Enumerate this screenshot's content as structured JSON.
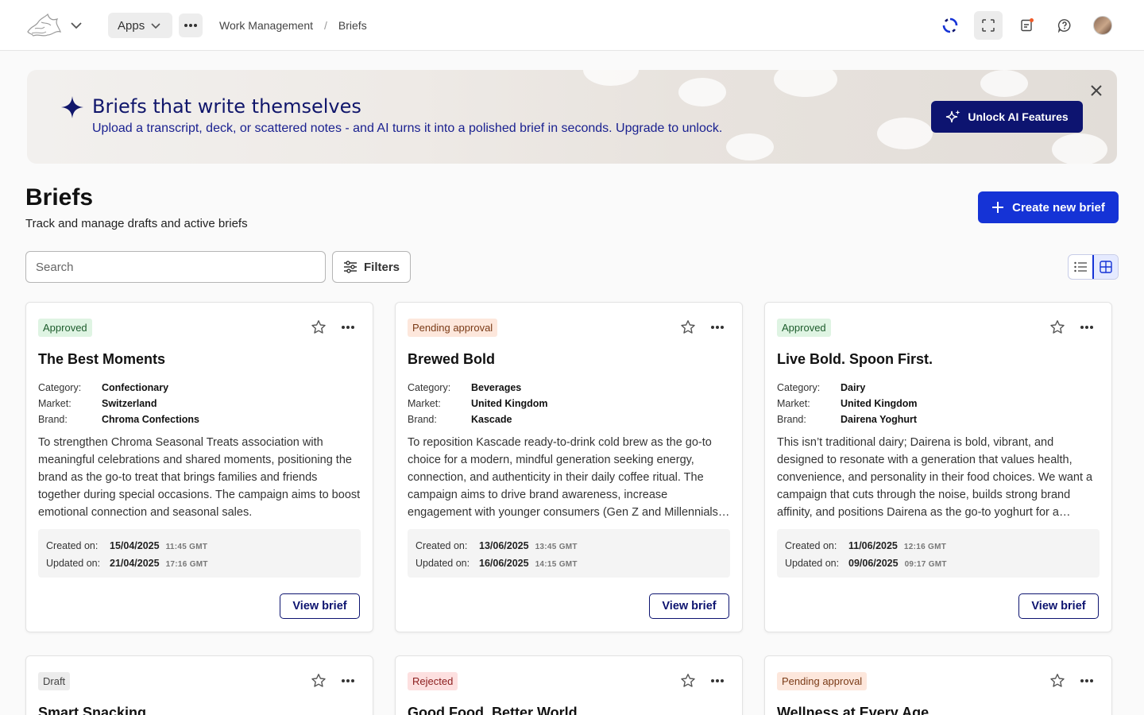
{
  "topbar": {
    "apps_label": "Apps",
    "breadcrumb": [
      "Work Management",
      "Briefs"
    ],
    "breadcrumb_sep": "/",
    "icons": [
      "logo-icon",
      "chevron-down-icon",
      "more-icon",
      "sync-icon",
      "focus-icon",
      "notes-icon",
      "help-icon",
      "avatar"
    ]
  },
  "banner": {
    "title": "Briefs that write themselves",
    "subtitle": "Upload a transcript, deck, or scattered notes - and AI turns it into a polished brief in seconds. Upgrade to unlock.",
    "cta_label": "Unlock AI Features"
  },
  "page": {
    "title": "Briefs",
    "subtitle": "Track and manage drafts and active briefs",
    "create_label": "Create new brief",
    "search_placeholder": "Search",
    "filters_label": "Filters",
    "view_mode": "grid"
  },
  "labels": {
    "category": "Category:",
    "market": "Market:",
    "brand": "Brand:",
    "created": "Created on:",
    "updated": "Updated on:",
    "view_brief": "View brief"
  },
  "cards": [
    {
      "status": "Approved",
      "title": "The Best Moments",
      "category": "Confectionary",
      "market": "Switzerland",
      "brand": "Chroma Confections",
      "description": "To strengthen Chroma Seasonal Treats association with meaningful celebrations and shared moments, positioning the brand as the go-to treat that brings families and friends together during special occasions. The campaign aims to boost emotional connection and seasonal sales.",
      "created_date": "15/04/2025",
      "created_time": "11:45 GMT",
      "updated_date": "21/04/2025",
      "updated_time": "17:16 GMT"
    },
    {
      "status": "Pending approval",
      "title": "Brewed Bold",
      "category": "Beverages",
      "market": "United Kingdom",
      "brand": "Kascade",
      "description": "To reposition Kascade ready-to-drink cold brew as the go-to choice for a modern, mindful generation seeking energy, connection, and authenticity in their daily coffee ritual. The campaign aims to drive brand awareness, increase engagement with younger consumers (Gen Z and Millennials), and build loyalty.",
      "created_date": "13/06/2025",
      "created_time": "13:45 GMT",
      "updated_date": "16/06/2025",
      "updated_time": "14:15 GMT"
    },
    {
      "status": "Approved",
      "title": "Live Bold. Spoon First.",
      "category": "Dairy",
      "market": "United Kingdom",
      "brand": "Dairena Yoghurt",
      "description": "This isn’t traditional dairy; Dairena is bold, vibrant, and designed to resonate with a generation that values health, convenience, and personality in their food choices. We want a campaign that cuts through the noise, builds strong brand affinity, and positions Dairena as the go-to yoghurt for a lifestyle on the move.",
      "created_date": "11/06/2025",
      "created_time": "12:16 GMT",
      "updated_date": "09/06/2025",
      "updated_time": "09:17 GMT"
    },
    {
      "status": "Draft",
      "title": "Smart Snacking"
    },
    {
      "status": "Rejected",
      "title": "Good Food, Better World"
    },
    {
      "status": "Pending approval",
      "title": "Wellness at Every Age"
    }
  ],
  "colors": {
    "primary": "#1533d6",
    "navy": "#0d1470",
    "approved_bg": "#dff4e3",
    "pending_bg": "#fde7dc",
    "draft_bg": "#ececec",
    "rejected_bg": "#fde0e0"
  }
}
